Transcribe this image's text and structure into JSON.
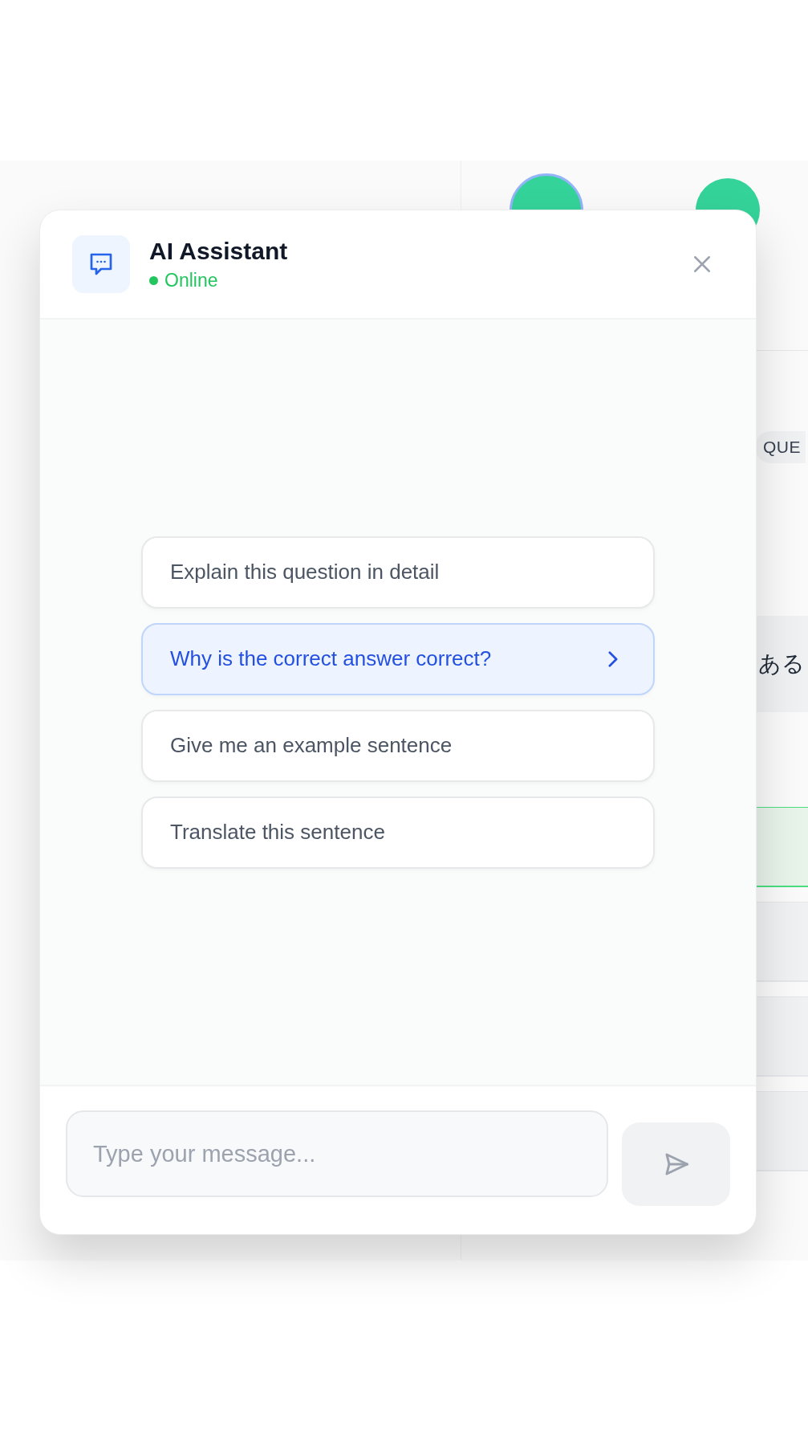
{
  "background": {
    "steps": [
      {
        "selected": true
      },
      {
        "selected": false
      }
    ],
    "badge": "QUE",
    "band_text": "ある",
    "rows": [
      {
        "kind": "correct"
      },
      {
        "kind": "plain"
      },
      {
        "kind": "plain"
      },
      {
        "kind": "plain"
      }
    ]
  },
  "chat": {
    "title": "AI Assistant",
    "status": "Online",
    "online": true,
    "suggestions": [
      {
        "label": "Explain this question in detail",
        "selected": false
      },
      {
        "label": "Why is the correct answer correct?",
        "selected": true
      },
      {
        "label": "Give me an example sentence",
        "selected": false
      },
      {
        "label": "Translate this sentence",
        "selected": false
      }
    ],
    "input": {
      "placeholder": "Type your message..."
    }
  }
}
